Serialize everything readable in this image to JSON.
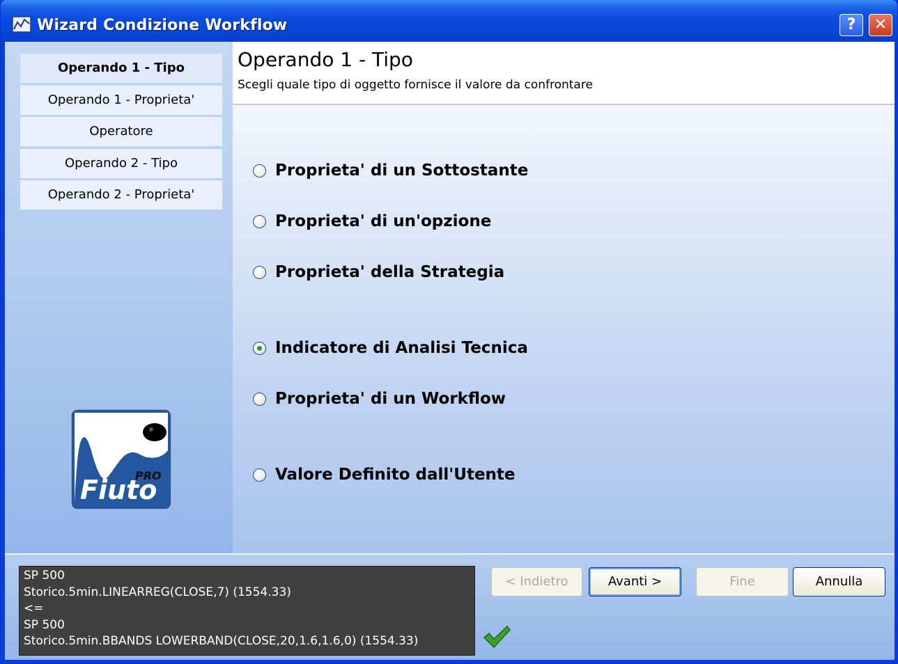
{
  "window": {
    "title": "Wizard Condizione Workflow",
    "help_label": "?",
    "close_label": "✕"
  },
  "steps": [
    {
      "label": "Operando 1 - Tipo"
    },
    {
      "label": "Operando 1 - Proprieta'"
    },
    {
      "label": "Operatore"
    },
    {
      "label": "Operando 2 - Tipo"
    },
    {
      "label": "Operando 2 - Proprieta'"
    }
  ],
  "logo": {
    "brand": "Fiuto",
    "edition": "PRO"
  },
  "header": {
    "title": "Operando 1 - Tipo",
    "subtitle": "Scegli quale tipo di oggetto fornisce il valore da confrontare"
  },
  "options": [
    {
      "label": "Proprieta' di un Sottostante",
      "selected": false
    },
    {
      "label": "Proprieta' di un'opzione",
      "selected": false
    },
    {
      "label": "Proprieta' della Strategia",
      "selected": false
    },
    {
      "label": "Indicatore di Analisi Tecnica",
      "selected": true
    },
    {
      "label": "Proprieta' di un Workflow",
      "selected": false
    },
    {
      "label": "Valore Definito dall'Utente",
      "selected": false
    }
  ],
  "summary": {
    "lines": [
      "SP 500",
      "Storico.5min.LINEARREG(CLOSE,7) (1554.33)",
      "<=",
      "SP 500",
      "Storico.5min.BBANDS LOWERBAND(CLOSE,20,1.6,1.6,0) (1554.33)"
    ]
  },
  "buttons": {
    "back": "< Indietro",
    "next": "Avanti >",
    "finish": "Fine",
    "cancel": "Annulla"
  },
  "colors": {
    "title_bar": "#0a4be0",
    "selected_radio": "#21a121",
    "check": "#3aa32a"
  }
}
